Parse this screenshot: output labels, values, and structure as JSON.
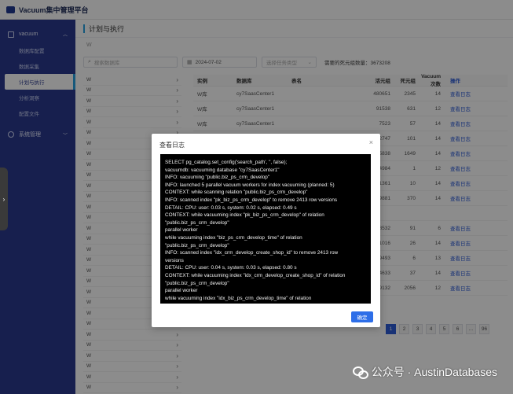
{
  "app": {
    "title": "Vacuum集中管理平台"
  },
  "sidebar": {
    "group": "vacuum",
    "items": [
      {
        "label": "数据库配置"
      },
      {
        "label": "数据采集"
      },
      {
        "label": "计划与执行"
      },
      {
        "label": "分析洞察"
      },
      {
        "label": "配置文件"
      }
    ],
    "system_label": "系统管理"
  },
  "main": {
    "page_title": "计划与执行",
    "sub_label": "W",
    "filters": {
      "search_placeholder": "搜索数据库",
      "date_value": "2024-07-02",
      "type_placeholder": "选择任务类型",
      "summary": "需要的死元组数量：3673208"
    },
    "left_list": [
      "W",
      "W",
      "W",
      "W",
      "W",
      "W",
      "W",
      "W",
      "W",
      "W",
      "W",
      "W",
      "W",
      "W",
      "W",
      "W",
      "W",
      "W",
      "W",
      "W",
      "W",
      "W",
      "W",
      "W",
      "W",
      "W",
      "W",
      "W",
      "W",
      "W"
    ],
    "table": {
      "headers": [
        "实例",
        "数据库",
        "表名",
        "活元组",
        "死元组",
        "Vacuum次数",
        "操作"
      ],
      "rows": [
        [
          "W库",
          "cy7SaasCenter1",
          "",
          "480651",
          "2345",
          "14",
          "查看日志"
        ],
        [
          "W库",
          "cy7SaasCenter1",
          "",
          "91538",
          "631",
          "12",
          "查看日志"
        ],
        [
          "W库",
          "cy7SaasCenter1",
          "",
          "7523",
          "57",
          "14",
          "查看日志"
        ],
        [
          "",
          "",
          "",
          "332747",
          "101",
          "14",
          "查看日志"
        ],
        [
          "",
          "",
          "",
          "675838",
          "1649",
          "14",
          "查看日志"
        ],
        [
          "",
          "",
          "",
          "4984",
          "1",
          "12",
          "查看日志"
        ],
        [
          "",
          "",
          "",
          "11361",
          "10",
          "14",
          "查看日志"
        ],
        [
          "",
          "",
          "",
          "409881",
          "370",
          "14",
          "查看日志"
        ],
        [
          "",
          "",
          "",
          "",
          "",
          "",
          ""
        ],
        [
          "",
          "",
          "",
          "18532",
          "91",
          "6",
          "查看日志"
        ],
        [
          "",
          "",
          "",
          "1016",
          "26",
          "14",
          "查看日志"
        ],
        [
          "",
          "",
          "",
          "9493",
          "6",
          "13",
          "查看日志"
        ],
        [
          "",
          "",
          "",
          "314633",
          "37",
          "14",
          "查看日志"
        ],
        [
          "",
          "",
          "",
          "469132",
          "2056",
          "12",
          "查看日志"
        ]
      ]
    },
    "pager": [
      "1",
      "2",
      "3",
      "4",
      "5",
      "6",
      "...",
      "96"
    ]
  },
  "dialog": {
    "title": "查看日志",
    "close": "×",
    "log_lines": [
      "SELECT pg_catalog.set_config('search_path', '', false);",
      "vacuumdb: vacuuming database \"cy7SaasCenter1\"",
      "INFO:  vacuuming \"public.biz_ps_crm_develop\"",
      "INFO:  launched 5 parallel vacuum workers for index vacuuming (planned: 5)",
      "CONTEXT:  while scanning relation \"public.biz_ps_crm_develop\"",
      "INFO:  scanned index \"pk_biz_ps_crm_develop\" to remove 2413 row versions",
      "DETAIL:  CPU: user: 0.03 s, system: 0.02 s, elapsed: 0.49 s",
      "CONTEXT:  while vacuuming index \"pk_biz_ps_crm_develop\" of relation",
      "\"public.biz_ps_crm_develop\"",
      "parallel worker",
      "while vacuuming index \"biz_ps_crm_develop_time\" of relation",
      "\"public.biz_ps_crm_develop\"",
      "INFO:  scanned index \"idx_crm_develop_create_shop_id\" to remove 2413 row",
      "versions",
      "DETAIL:  CPU: user: 0.04 s, system: 0.03 s, elapsed: 0.80 s",
      "CONTEXT:  while vacuuming index \"idx_crm_develop_create_shop_id\" of relation",
      "\"public.biz_ps_crm_develop\"",
      "parallel worker",
      "while vacuuming index \"idx_biz_ps_crm_develop_time\" of relation"
    ],
    "ok_label": "确定"
  },
  "watermark": {
    "text": "公众号 · AustinDatabases"
  }
}
